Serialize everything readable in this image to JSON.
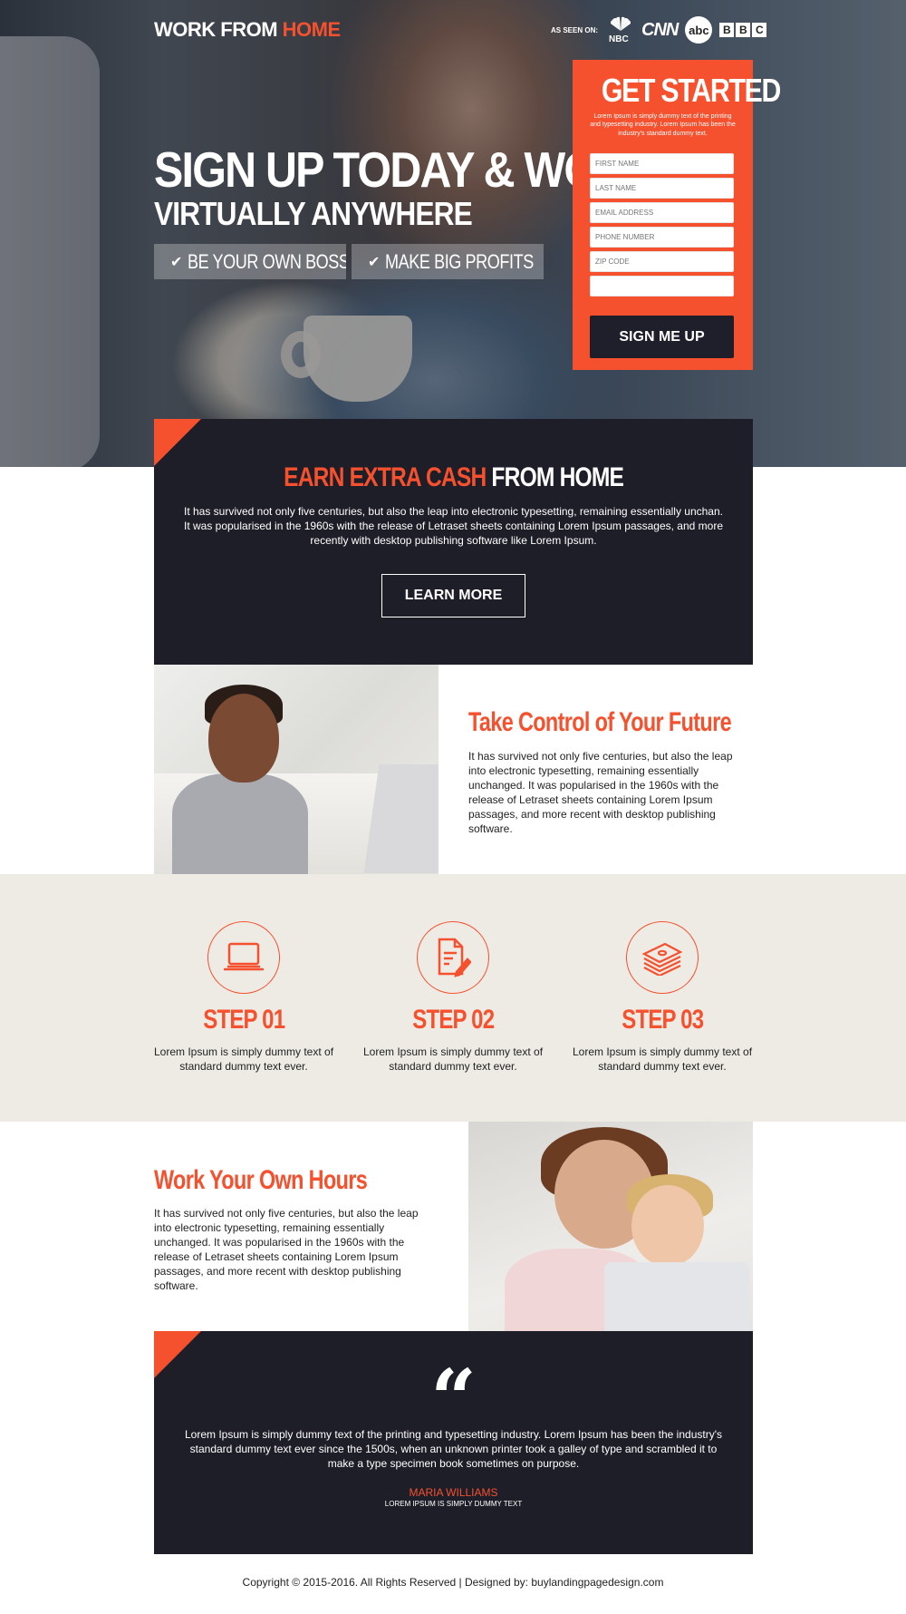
{
  "header": {
    "logo_main": "WORK FROM",
    "logo_accent": "HOME",
    "as_seen_on": "AS SEEN ON:",
    "media": {
      "nbc": "NBC",
      "cnn": "CNN",
      "abc": "abc",
      "bbc": [
        "B",
        "B",
        "C"
      ]
    }
  },
  "hero": {
    "headline": "SIGN UP TODAY & WORK",
    "subheadline": "VIRTUALLY ANYWHERE",
    "pills": [
      "BE YOUR OWN BOSS",
      "MAKE BIG PROFITS"
    ]
  },
  "form": {
    "title": "GET STARTED",
    "subtitle": "Lorem Ipsum is simply dummy text of the printing and typesetting industry. Lorem Ipsum has been the industry's standard dummy text.",
    "fields": [
      {
        "placeholder": "FIRST NAME"
      },
      {
        "placeholder": "LAST NAME"
      },
      {
        "placeholder": "EMAIL ADDRESS"
      },
      {
        "placeholder": "PHONE NUMBER"
      },
      {
        "placeholder": "ZIP CODE"
      },
      {
        "placeholder": ""
      }
    ],
    "submit_label": "SIGN ME UP"
  },
  "earn": {
    "title_accent": "EARN EXTRA CASH",
    "title_rest": "FROM HOME",
    "text": "It has survived not only five centuries, but also the leap into electronic typesetting, remaining essentially unchan. It was popularised in the 1960s with the release of Letraset sheets containing Lorem Ipsum passages, and more recently with desktop publishing software like Lorem Ipsum.",
    "button_label": "LEARN MORE"
  },
  "take_control": {
    "title": "Take Control of Your Future",
    "text": "It has survived not only five centuries, but also the leap into electronic typesetting, remaining essentially unchanged. It was popularised in the 1960s with the release of Letraset sheets containing Lorem Ipsum passages, and more recent with desktop publishing software."
  },
  "steps": [
    {
      "title": "STEP 01",
      "text": "Lorem Ipsum is simply dummy text of standard dummy text ever.",
      "icon": "laptop-icon"
    },
    {
      "title": "STEP 02",
      "text": "Lorem Ipsum is simply dummy text of standard dummy text ever.",
      "icon": "document-edit-icon"
    },
    {
      "title": "STEP 03",
      "text": "Lorem Ipsum is simply dummy text of standard dummy text ever.",
      "icon": "money-stack-icon"
    }
  ],
  "work_hours": {
    "title": "Work Your Own Hours",
    "text": "It has survived not only five centuries, but also the leap into electronic typesetting, remaining essentially unchanged. It was popularised in the 1960s with the release of Letraset sheets containing Lorem Ipsum passages, and more recent with desktop publishing software."
  },
  "testimonial": {
    "quote_mark": "“",
    "text": "Lorem Ipsum is simply dummy text of the printing and typesetting industry. Lorem Ipsum has been the industry's standard dummy text ever since the 1500s, when an unknown printer took a galley of type and scrambled it to make a type specimen book sometimes on purpose.",
    "name": "MARIA WILLIAMS",
    "role": "LOREM IPSUM IS SIMPLY DUMMY TEXT"
  },
  "footer": {
    "text": "Copyright © 2015-2016. All Rights Reserved  |  Designed by: buylandingpagedesign.com"
  },
  "colors": {
    "accent": "#f5512e",
    "dark": "#1e1e29",
    "steps_bg": "#eeebe5"
  }
}
